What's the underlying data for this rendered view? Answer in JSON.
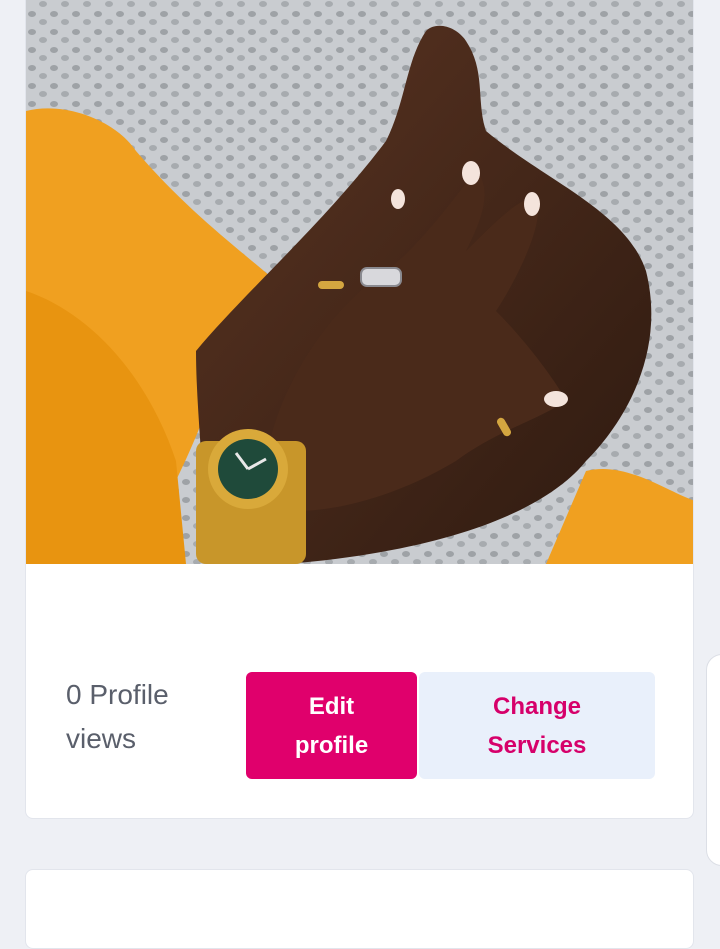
{
  "profile": {
    "photo_icon": "profile-photo",
    "views_count": "0",
    "views_label_line1": "Profile",
    "views_label_line2": "views",
    "edit_button_line1": "Edit",
    "edit_button_line2": "profile",
    "change_button_line1": "Change",
    "change_button_line2": "Services"
  },
  "colors": {
    "primary": "#e0006c",
    "secondary_bg": "#e9f0fb",
    "secondary_text": "#d6006a",
    "page_bg": "#eef0f5",
    "muted_text": "#5a5f6b"
  }
}
